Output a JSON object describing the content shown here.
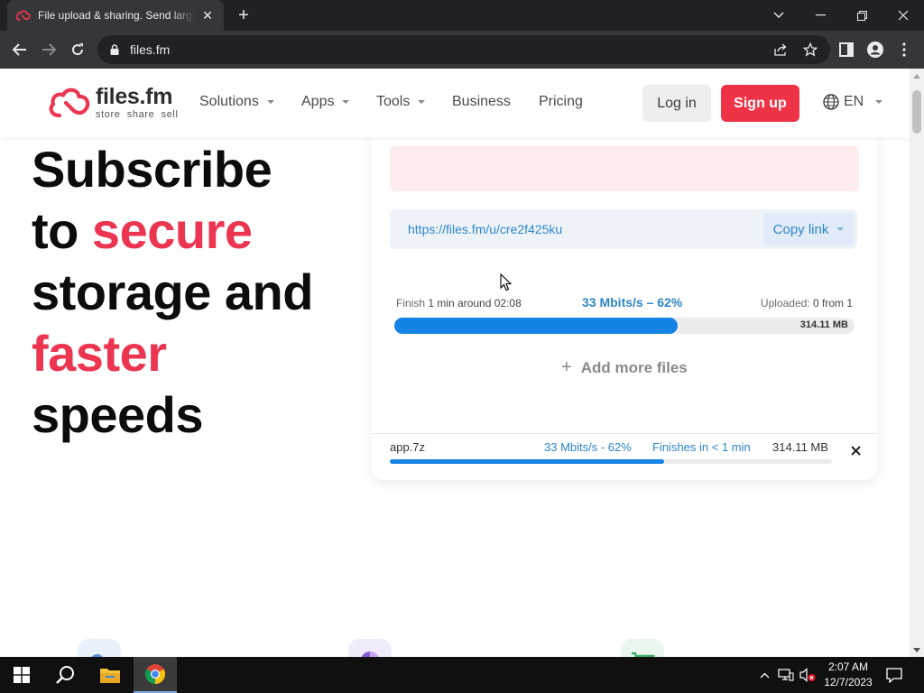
{
  "browser": {
    "tab_title": "File upload & sharing. Send large files",
    "url": "files.fm"
  },
  "header": {
    "logo_name": "files.fm",
    "logo_tagline": "store  share  sell",
    "nav": [
      "Solutions",
      "Apps",
      "Tools",
      "Business",
      "Pricing"
    ],
    "login_label": "Log in",
    "signup_label": "Sign up",
    "language": "EN"
  },
  "hero": {
    "line1": "Subscribe",
    "line2a": "to ",
    "line2b": "secure",
    "line3": "storage and",
    "line4": "faster",
    "line5": "speeds"
  },
  "upload": {
    "share_link": "https://files.fm/u/cre2f425ku",
    "copy_link_label": "Copy link",
    "finish_label": "Finish",
    "finish_value": "1 min around 02:08",
    "speed_progress": "33 Mbits/s – 62%",
    "uploaded_label": "Uploaded:",
    "uploaded_value": "0 from 1",
    "total_size": "314.11 MB",
    "progress": 0.615,
    "add_more_label": "Add more files"
  },
  "file_row": {
    "name": "app.7z",
    "speed": "33 Mbits/s - 62%",
    "finishes": "Finishes in < 1 min",
    "size": "314.11 MB",
    "progress": 0.62
  },
  "taskbar": {
    "time": "2:07 AM",
    "date": "12/7/2023"
  },
  "colors": {
    "brand_red": "#ec3550",
    "signup_red": "#ee3347",
    "progress_blue": "#1583e5",
    "link_blue": "#2f86c6"
  }
}
